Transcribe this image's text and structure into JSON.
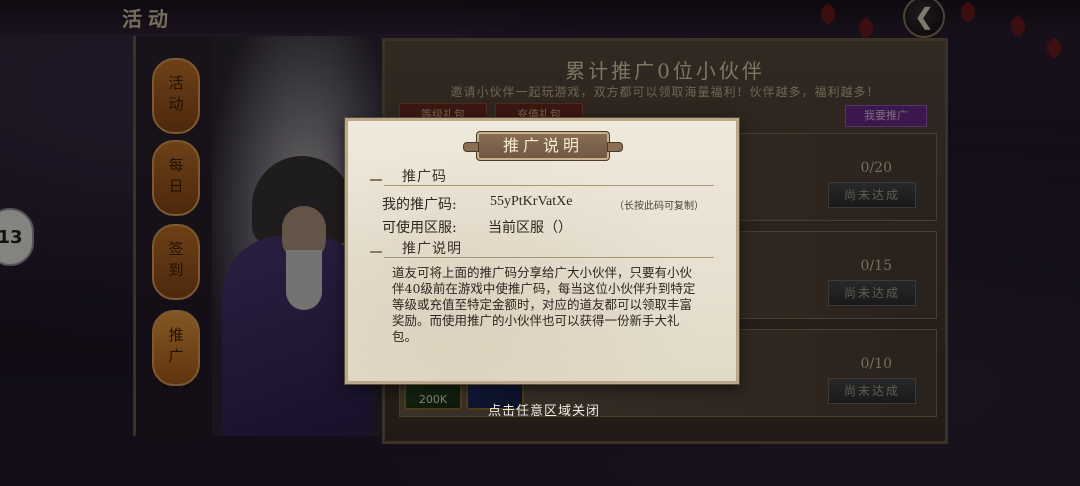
{
  "top": {
    "title": "活动"
  },
  "back_button": {
    "label": "❮"
  },
  "sidebar": {
    "items": [
      {
        "label": "活动"
      },
      {
        "label": "每日"
      },
      {
        "label": "签到"
      },
      {
        "label": "推广"
      }
    ]
  },
  "side_badge": {
    "label": "13"
  },
  "main": {
    "title": "累计推广0位小伙伴",
    "subtitle": "邀请小伙伴一起玩游戏，双方都可以领取海量福利！伙伴越多，福利越多！",
    "tabs": [
      {
        "label": "等级礼包"
      },
      {
        "label": "充值礼包"
      }
    ],
    "promo_button": "我要推广",
    "tasks": [
      {
        "count": "0/20",
        "button": "尚未达成"
      },
      {
        "count": "0/15",
        "button": "尚未达成"
      },
      {
        "count": "0/10",
        "button": "尚未达成"
      }
    ],
    "rewards": [
      {
        "label": "200K"
      }
    ]
  },
  "modal": {
    "title": "推广说明",
    "section_code": "推广码",
    "my_code_label": "我的推广码:",
    "my_code_value": "55yPtKrVatXe",
    "copy_hint": "（长按此码可复制）",
    "server_label": "可使用区服:",
    "server_value": "当前区服（）",
    "section_desc": "推广说明",
    "description": "道友可将上面的推广码分享给广大小伙伴，只要有小伙伴40级前在游戏中使推广码，每当这位小伙伴升到特定等级或充值至特定金额时，对应的道友都可以领取丰富奖励。而使用推广的小伙伴也可以获得一份新手大礼包。",
    "close_hint": "点击任意区域关闭"
  },
  "colors": {
    "accent_orange": "#c7762a",
    "modal_bg": "#efe9dc",
    "title_brown": "#8b6f55",
    "promo_purple": "#6a2a8a"
  }
}
